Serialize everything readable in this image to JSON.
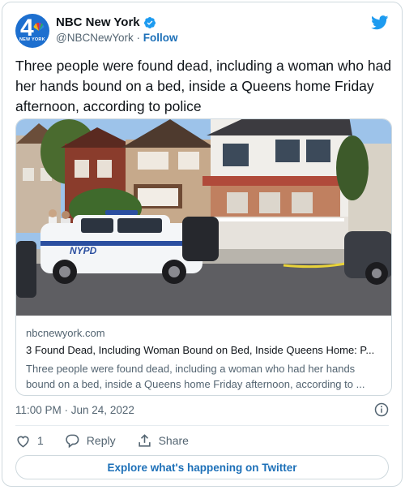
{
  "account": {
    "display_name": "NBC New York",
    "handle": "@NBCNewYork",
    "separator": "·",
    "follow_label": "Follow",
    "avatar_number": "4",
    "avatar_sub": "NEW YORK"
  },
  "tweet": {
    "text": "Three people were found dead, including a woman who had her hands bound on a bed, inside a Queens home Friday afternoon, according to police",
    "timestamp": "11:00 PM · Jun 24, 2022"
  },
  "link_card": {
    "domain": "nbcnewyork.com",
    "title": "3 Found Dead, Including Woman Bound on Bed, Inside Queens Home: P...",
    "description": "Three people were found dead, including a woman who had her hands bound on a bed, inside a Queens home Friday afternoon, according to ...",
    "car_text": "NYPD"
  },
  "actions": {
    "like_count": "1",
    "reply_label": "Reply",
    "share_label": "Share"
  },
  "explore_label": "Explore what's happening on Twitter",
  "colors": {
    "brand_blue": "#1d9bf0",
    "link_blue": "#1d70b8",
    "muted": "#536471"
  }
}
